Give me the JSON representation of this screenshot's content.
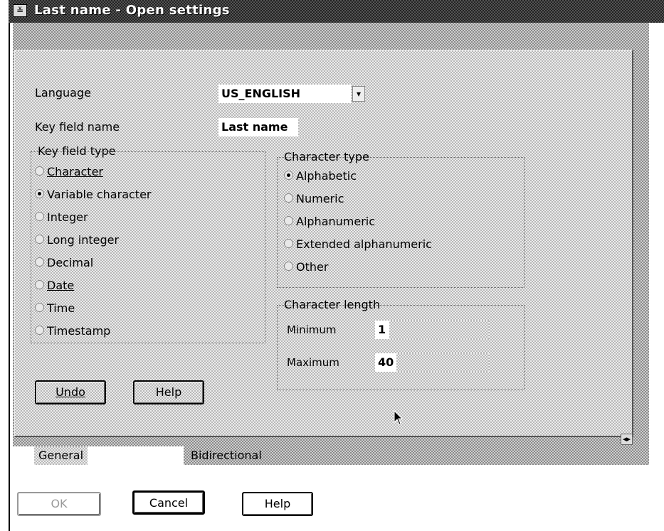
{
  "window": {
    "title": "Last name - Open settings",
    "system_menu_glyph": "≚"
  },
  "form": {
    "language_label": "Language",
    "language_value": "US_ENGLISH",
    "dropdown_glyph": "▾",
    "key_field_name_label": "Key field name",
    "key_field_name_value": "Last name"
  },
  "key_field_type": {
    "title": "Key field type",
    "options": [
      {
        "label": "Character",
        "selected": false
      },
      {
        "label": "Variable character",
        "selected": true
      },
      {
        "label": "Integer",
        "selected": false
      },
      {
        "label": "Long integer",
        "selected": false
      },
      {
        "label": "Decimal",
        "selected": false
      },
      {
        "label": "Date",
        "selected": false
      },
      {
        "label": "Time",
        "selected": false
      },
      {
        "label": "Timestamp",
        "selected": false
      }
    ]
  },
  "character_type": {
    "title": "Character type",
    "options": [
      {
        "label": "Alphabetic",
        "selected": true
      },
      {
        "label": "Numeric",
        "selected": false
      },
      {
        "label": "Alphanumeric",
        "selected": false
      },
      {
        "label": "Extended alphanumeric",
        "selected": false
      },
      {
        "label": "Other",
        "selected": false
      }
    ]
  },
  "character_length": {
    "title": "Character length",
    "minimum_label": "Minimum",
    "minimum_value": "1",
    "maximum_label": "Maximum",
    "maximum_value": "40"
  },
  "page_buttons": {
    "undo": "Undo",
    "help": "Help"
  },
  "tabs": {
    "general": "General",
    "bidirectional": "Bidirectional",
    "scroll_arrows": "◂▸"
  },
  "dialog_buttons": {
    "ok": "OK",
    "cancel": "Cancel",
    "help": "Help"
  }
}
